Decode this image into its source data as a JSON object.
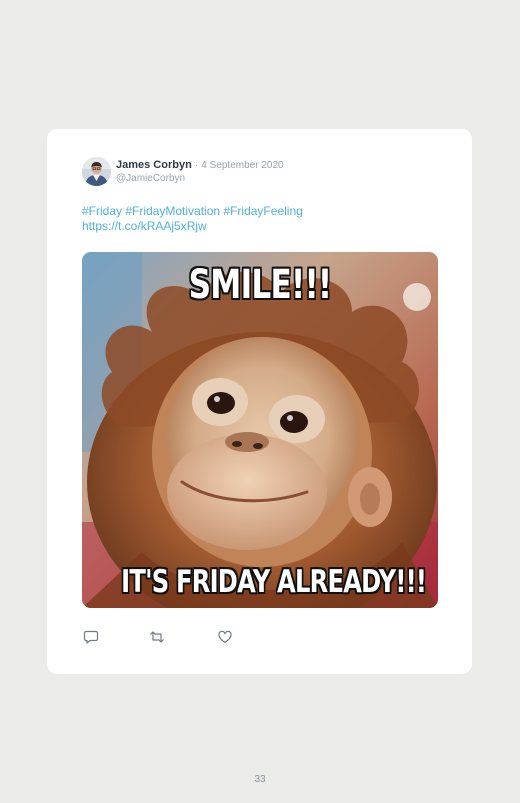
{
  "tweet": {
    "author_name": "James Corbyn",
    "separator": "·",
    "date": "4 September 2020",
    "handle": "@JamieCorbyn",
    "hashtags": [
      "#Friday",
      "#FridayMotivation",
      "#FridayFeeling"
    ],
    "link": "https://t.co/kRAAj5xRjw"
  },
  "image": {
    "caption_top": "SMILE!!!",
    "caption_bottom": "IT'S FRIDAY ALREADY!!!"
  },
  "actions": {
    "reply_icon": "reply-icon",
    "retweet_icon": "retweet-icon",
    "like_icon": "like-icon"
  },
  "page": {
    "number": "33"
  },
  "colors": {
    "background": "#ebebea",
    "card": "#ffffff",
    "link": "#4fb0e0",
    "name": "#2f3a45",
    "muted": "#9aa3ab"
  }
}
